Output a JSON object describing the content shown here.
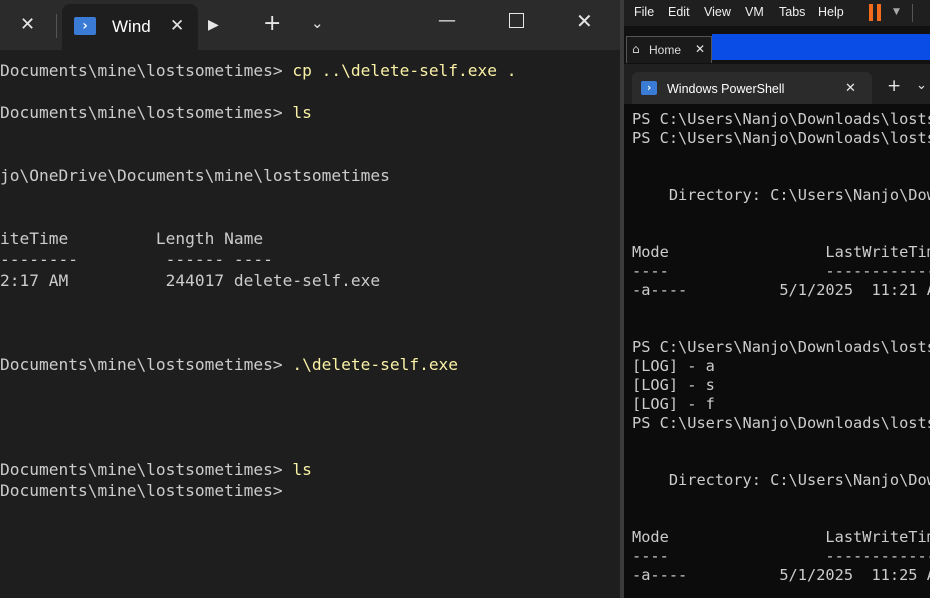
{
  "left_window": {
    "tab_title": "Wind",
    "terminal_lines": [
      {
        "prefix": "Documents\\mine\\lostsometimes> ",
        "cmd": "cp ..\\delete-self.exe ."
      },
      {
        "prefix": "",
        "cmd": ""
      },
      {
        "prefix": "Documents\\mine\\lostsometimes> ",
        "cmd": "ls"
      },
      {
        "prefix": "",
        "cmd": ""
      },
      {
        "prefix": "",
        "cmd": ""
      },
      {
        "prefix": "jo\\OneDrive\\Documents\\mine\\lostsometimes",
        "cmd": ""
      },
      {
        "prefix": "",
        "cmd": ""
      },
      {
        "prefix": "",
        "cmd": ""
      },
      {
        "prefix": "iteTime         Length Name",
        "cmd": ""
      },
      {
        "prefix": "--------         ------ ----",
        "cmd": ""
      },
      {
        "prefix": "2:17 AM          244017 delete-self.exe",
        "cmd": ""
      },
      {
        "prefix": "",
        "cmd": ""
      },
      {
        "prefix": "",
        "cmd": ""
      },
      {
        "prefix": "",
        "cmd": ""
      },
      {
        "prefix": "Documents\\mine\\lostsometimes> ",
        "cmd": ".\\delete-self.exe"
      },
      {
        "prefix": "",
        "cmd": ""
      },
      {
        "prefix": "",
        "cmd": ""
      },
      {
        "prefix": "",
        "cmd": ""
      },
      {
        "prefix": "",
        "cmd": ""
      },
      {
        "prefix": "Documents\\mine\\lostsometimes> ",
        "cmd": "ls"
      },
      {
        "prefix": "Documents\\mine\\lostsometimes>",
        "cmd": ""
      }
    ]
  },
  "right_window": {
    "menu": [
      "File",
      "Edit",
      "View",
      "VM",
      "Tabs",
      "Help"
    ],
    "home_tab_label": "Home",
    "ps_tab_title": "Windows PowerShell",
    "terminal_lines": [
      "PS C:\\Users\\Nanjo\\Downloads\\losts",
      "PS C:\\Users\\Nanjo\\Downloads\\losts",
      "",
      "",
      "    Directory: C:\\Users\\Nanjo\\Dow",
      "",
      "",
      "Mode                 LastWriteTim",
      "----                 ------------",
      "-a----          5/1/2025  11:21 A",
      "",
      "",
      "PS C:\\Users\\Nanjo\\Downloads\\losts",
      "[LOG] - a",
      "[LOG] - s",
      "[LOG] - f",
      "PS C:\\Users\\Nanjo\\Downloads\\losts",
      "",
      "",
      "    Directory: C:\\Users\\Nanjo\\Dow",
      "",
      "",
      "Mode                 LastWriteTim",
      "----                 ------------",
      "-a----          5/1/2025  11:25 A"
    ]
  },
  "colors": {
    "left_bg": "#1e1e1e",
    "right_bg": "#0c0c0c",
    "command_yellow": "#f9f1a5",
    "accent_blue": "#0a4ce6",
    "pause_orange": "#f26b1d"
  }
}
